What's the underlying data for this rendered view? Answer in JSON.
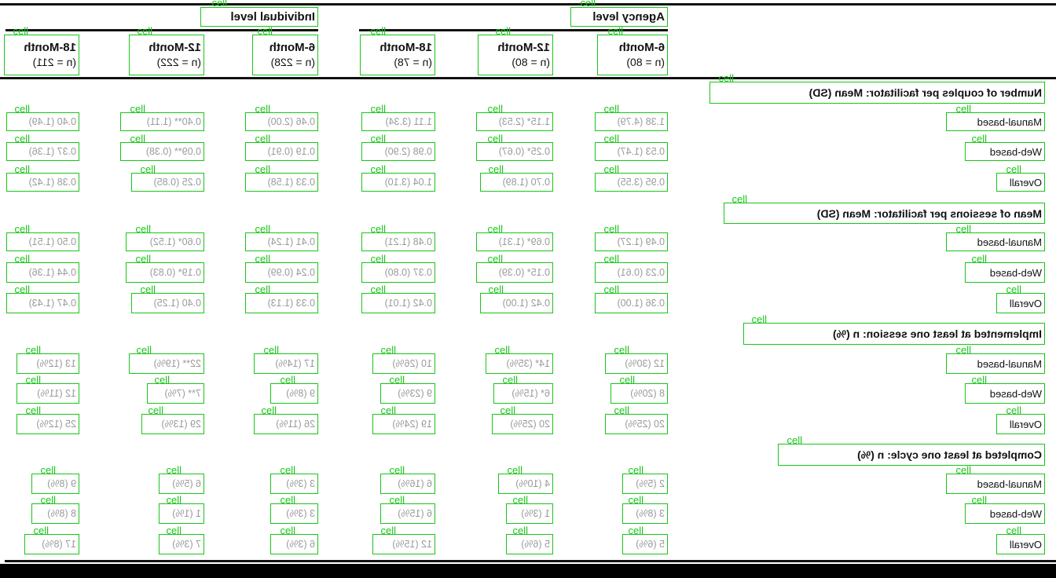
{
  "tag_label": "cell",
  "header": {
    "agency_level": "Agency level",
    "individual_level": "Individual level",
    "columns": [
      {
        "title": "6-Month",
        "n": "(n = 80)"
      },
      {
        "title": "12-Month",
        "n": "(n = 80)"
      },
      {
        "title": "18-Month",
        "n": "(n = 78)"
      },
      {
        "title": "6-Month",
        "n": "(n = 228)"
      },
      {
        "title": "12-Month",
        "n": "(n = 222)"
      },
      {
        "title": "18-Month",
        "n": "(n = 211)"
      }
    ]
  },
  "sections": [
    {
      "title": "Number of couples per facilitator: Mean (SD)",
      "rows": [
        {
          "label": "Manual-based",
          "values": [
            "1.38 (4.79)",
            "1.15* (2.53)",
            "1.11 (3.34)",
            "0.46 (2.00)",
            "0.40** (1.11)",
            "0.40 (1.49)"
          ]
        },
        {
          "label": "Web-based",
          "values": [
            "0.53 (1.47)",
            "0.25* (0.67)",
            "0.98 (2.90)",
            "0.19 (0.91)",
            "0.09** (0.38)",
            "0.37 (1.36)"
          ]
        },
        {
          "label": "Overall",
          "values": [
            "0.95 (3.55)",
            "0.70 (1.89)",
            "1.04 (3.10)",
            "0.33 (1.58)",
            "0.25 (0.85)",
            "0.38 (1.42)"
          ]
        }
      ]
    },
    {
      "title": "Mean of sessions per facilitator: Mean (SD)",
      "rows": [
        {
          "label": "Manual-based",
          "values": [
            "0.49 (1.27)",
            "0.69* (1.31)",
            "0.48 (1.21)",
            "0.41 (1.24)",
            "0.60* (1.52)",
            "0.50 (1.51)"
          ]
        },
        {
          "label": "Web-based",
          "values": [
            "0.23 (0.61)",
            "0.15* (0.39)",
            "0.37 (0.80)",
            "0.24 (0.99)",
            "0.19* (0.83)",
            "0.44 (1.36)"
          ]
        },
        {
          "label": "Overall",
          "values": [
            "0.36 (1.00)",
            "0.42 (1.00)",
            "0.42 (1.01)",
            "0.33 (1.13)",
            "0.40 (1.25)",
            "0.47 (1.43)"
          ]
        }
      ]
    },
    {
      "title": "Implemented at least one session: n (%)",
      "rows": [
        {
          "label": "Manual-based",
          "values": [
            "12 (30%)",
            "14* (35%)",
            "10 (26%)",
            "17 (14%)",
            "22** (19%)",
            "13 (12%)"
          ]
        },
        {
          "label": "Web-based",
          "values": [
            "8 (20%)",
            "6* (15%)",
            "9 (23%)",
            "9 (8%)",
            "7** (7%)",
            "12 (11%)"
          ]
        },
        {
          "label": "Overall",
          "values": [
            "20 (25%)",
            "20 (25%)",
            "19 (24%)",
            "26 (11%)",
            "29 (13%)",
            "25 (12%)"
          ]
        }
      ]
    },
    {
      "title": "Completed at least one cycle: n (%)",
      "rows": [
        {
          "label": "Manual-based",
          "values": [
            "2 (5%)",
            "4 (10%)",
            "6 (16%)",
            "3 (3%)",
            "6 (5%)",
            "9 (8%)"
          ]
        },
        {
          "label": "Web-based",
          "values": [
            "3 (8%)",
            "1 (3%)",
            "6 (15%)",
            "3 (3%)",
            "1 (1%)",
            "8 (8%)"
          ]
        },
        {
          "label": "Overall",
          "values": [
            "5 (6%)",
            "5 (6%)",
            "12 (15%)",
            "6 (3%)",
            "7 (3%)",
            "17 (8%)"
          ]
        }
      ]
    }
  ]
}
